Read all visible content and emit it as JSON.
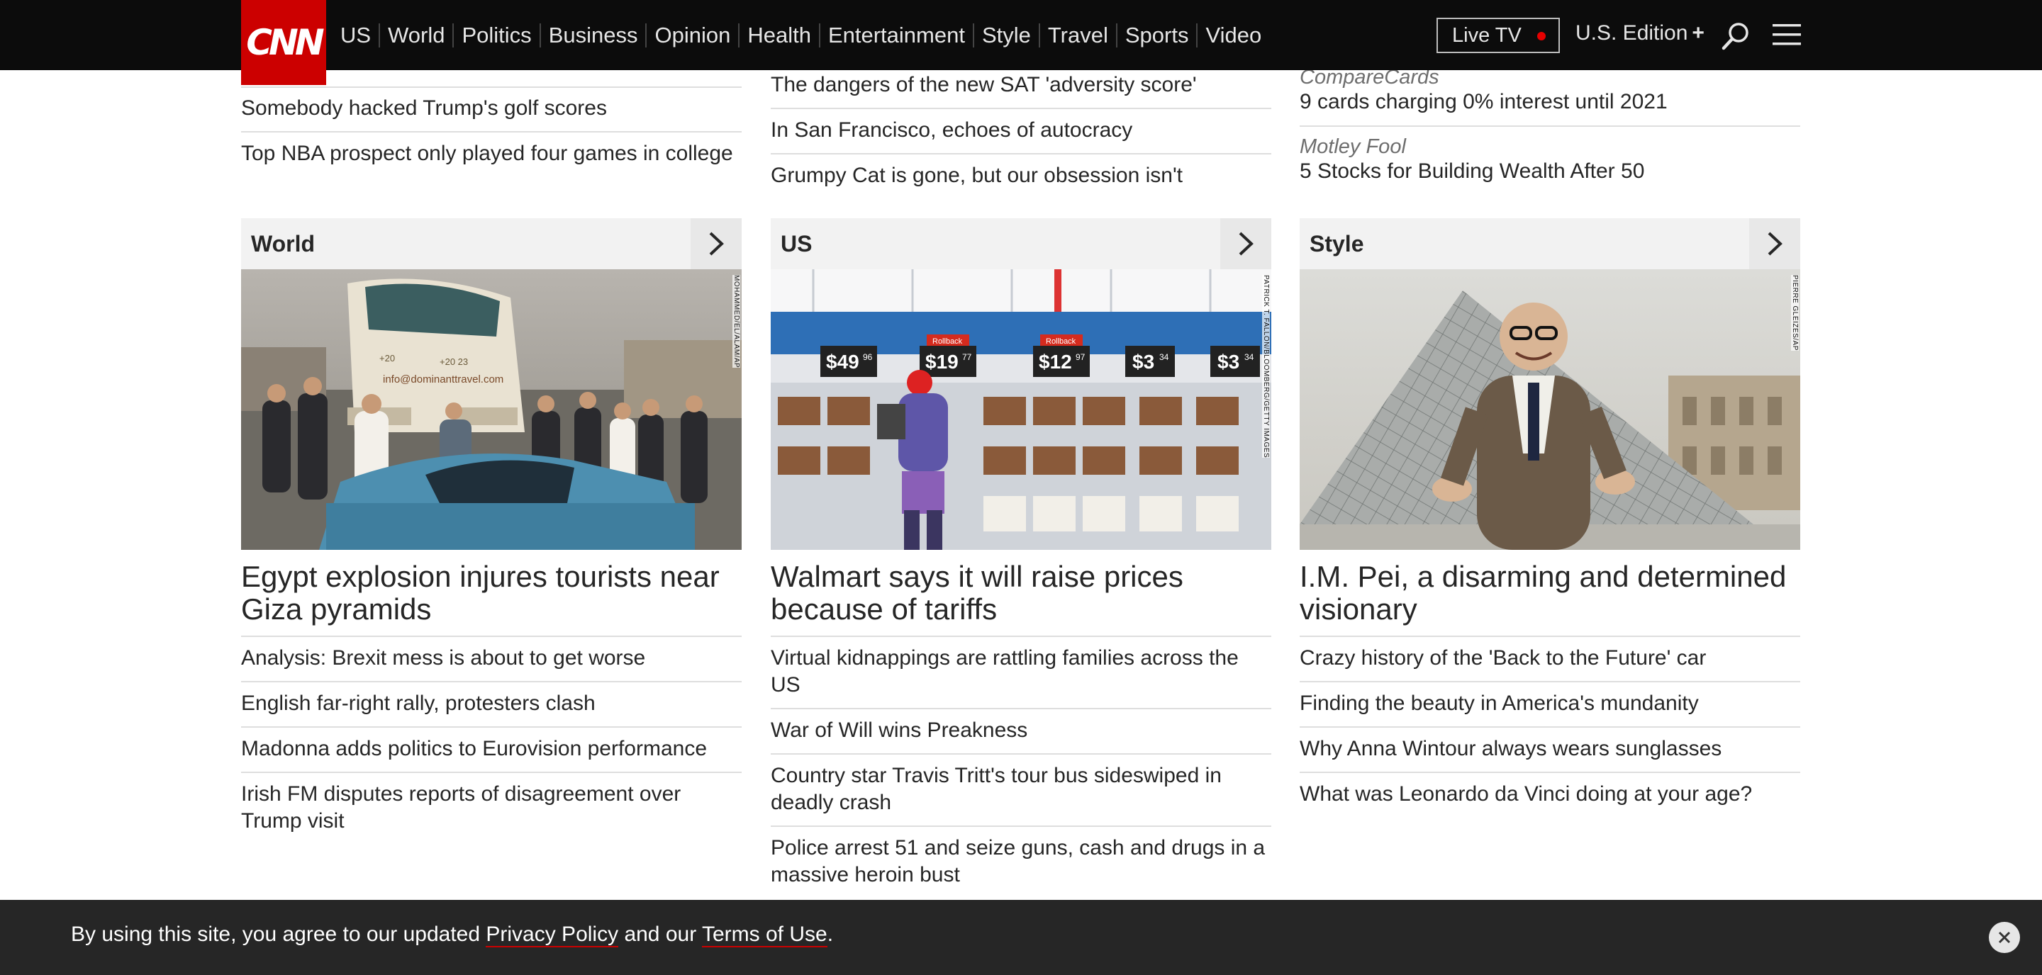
{
  "header": {
    "logo": "CNN",
    "nav": [
      "US",
      "World",
      "Politics",
      "Business",
      "Opinion",
      "Health",
      "Entertainment",
      "Style",
      "Travel",
      "Sports",
      "Video"
    ],
    "live_tv": "Live TV",
    "edition": "U.S. Edition",
    "edition_plus": "+"
  },
  "top_lists": {
    "left": [
      "Somebody hacked Trump's golf scores",
      "Top NBA prospect only played four games in college"
    ],
    "middle": [
      "The dangers of the new SAT 'adversity score'",
      "In San Francisco, echoes of autocracy",
      "Grumpy Cat is gone, but our obsession isn't"
    ],
    "right": [
      {
        "source": "CompareCards",
        "title": "9 cards charging 0% interest until 2021"
      },
      {
        "source": "Motley Fool",
        "title": "5 Stocks for Building Wealth After 50"
      }
    ]
  },
  "zones": [
    {
      "title": "World",
      "credit": "MOHAMMED/EL/ALAM/AP",
      "headline": "Egypt explosion injures tourists near Giza pyramids",
      "stories": [
        "Analysis: Brexit mess is about to get worse",
        "English far-right rally, protesters clash",
        "Madonna adds politics to Eurovision performance",
        "Irish FM disputes reports of disagreement over Trump visit"
      ]
    },
    {
      "title": "US",
      "credit": "PATRICK T. FALLON/BLOOMBERG/GETTY IMAGES",
      "headline": "Walmart says it will raise prices because of tariffs",
      "stories": [
        "Virtual kidnappings are rattling families across the US",
        "War of Will wins Preakness",
        "Country star Travis Tritt's tour bus sideswiped in deadly crash",
        "Police arrest 51 and seize guns, cash and drugs in a massive heroin bust"
      ]
    },
    {
      "title": "Style",
      "credit": "PIERRE GLEIZES/AP",
      "headline": "I.M. Pei, a disarming and determined visionary",
      "stories": [
        "Crazy history of the 'Back to the Future' car",
        "Finding the beauty in America's mundanity",
        "Why Anna Wintour always wears sunglasses",
        "What was Leonardo da Vinci doing at your age?"
      ]
    }
  ],
  "store_prices": [
    "$49",
    "96",
    "$19",
    "77",
    "$12",
    "97",
    "$3",
    "34",
    "$3",
    "34"
  ],
  "store_tags": [
    "Rollback",
    "Rollback"
  ],
  "bus_text": [
    "info@dominanttravel.com",
    "+20",
    "+20 23"
  ],
  "cookie": {
    "prefix": "By using this site, you agree to our updated",
    "privacy": "Privacy Policy",
    "middle": "and our",
    "terms": "Terms of Use",
    "suffix": "."
  },
  "colors": {
    "brand_red": "#cc0000",
    "header_bg": "#0c0c0c",
    "banner_bg": "#262626"
  }
}
